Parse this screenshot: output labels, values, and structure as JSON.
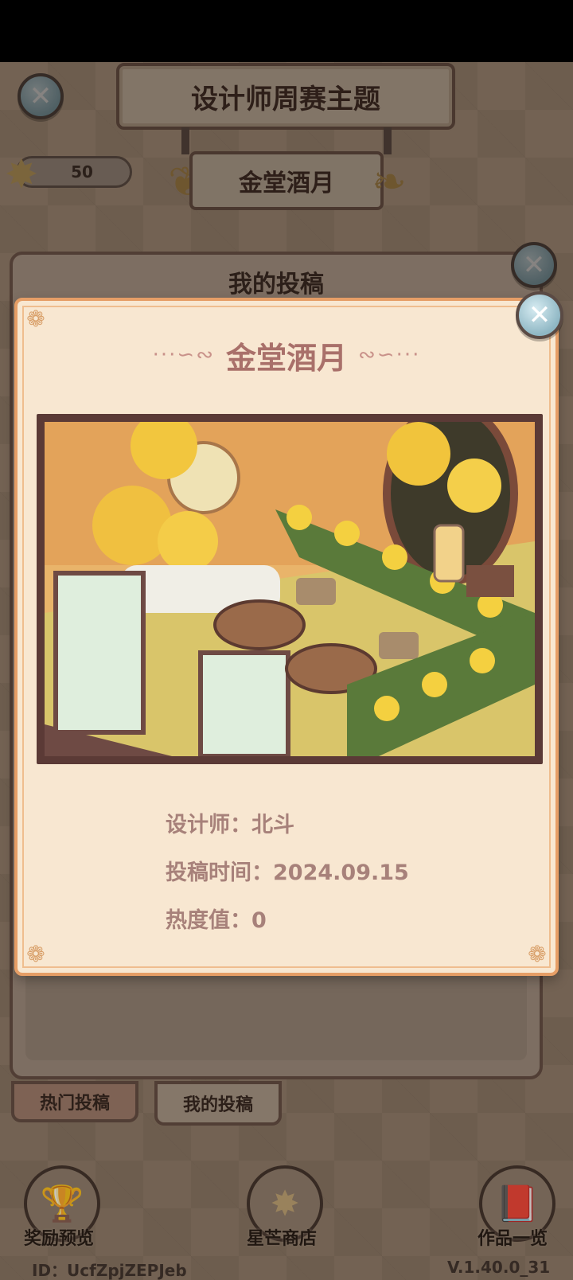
{
  "header": {
    "title": "设计师周赛主题",
    "theme_name": "金堂酒月"
  },
  "currency": {
    "stars": "50",
    "icon": "star-icon"
  },
  "back_panel": {
    "title": "我的投稿"
  },
  "tabs": [
    {
      "label": "热门投稿",
      "selected": false
    },
    {
      "label": "我的投稿",
      "selected": true
    }
  ],
  "dock": {
    "rewards": {
      "label": "奖励预览",
      "icon": "trophy-icon"
    },
    "shop": {
      "label": "星芒商店",
      "icon": "star-icon"
    },
    "works": {
      "label": "作品一览",
      "icon": "book-icon"
    }
  },
  "footer": {
    "user_id": "ID：UcfZpjZEPJeb",
    "version": "V.1.40.0_31"
  },
  "modal": {
    "title": "金堂酒月",
    "designer_label": "设计师：",
    "designer_value": "北斗",
    "submit_time_label": "投稿时间：",
    "submit_time_value": "2024.09.15",
    "heat_label": "热度值：",
    "heat_value": "0"
  },
  "colors": {
    "modal_bg": "#f8e7d1",
    "modal_border": "#e69e66",
    "title_text": "#a9706a",
    "info_text": "#a7817a",
    "close_button": "#b8dbe6"
  }
}
